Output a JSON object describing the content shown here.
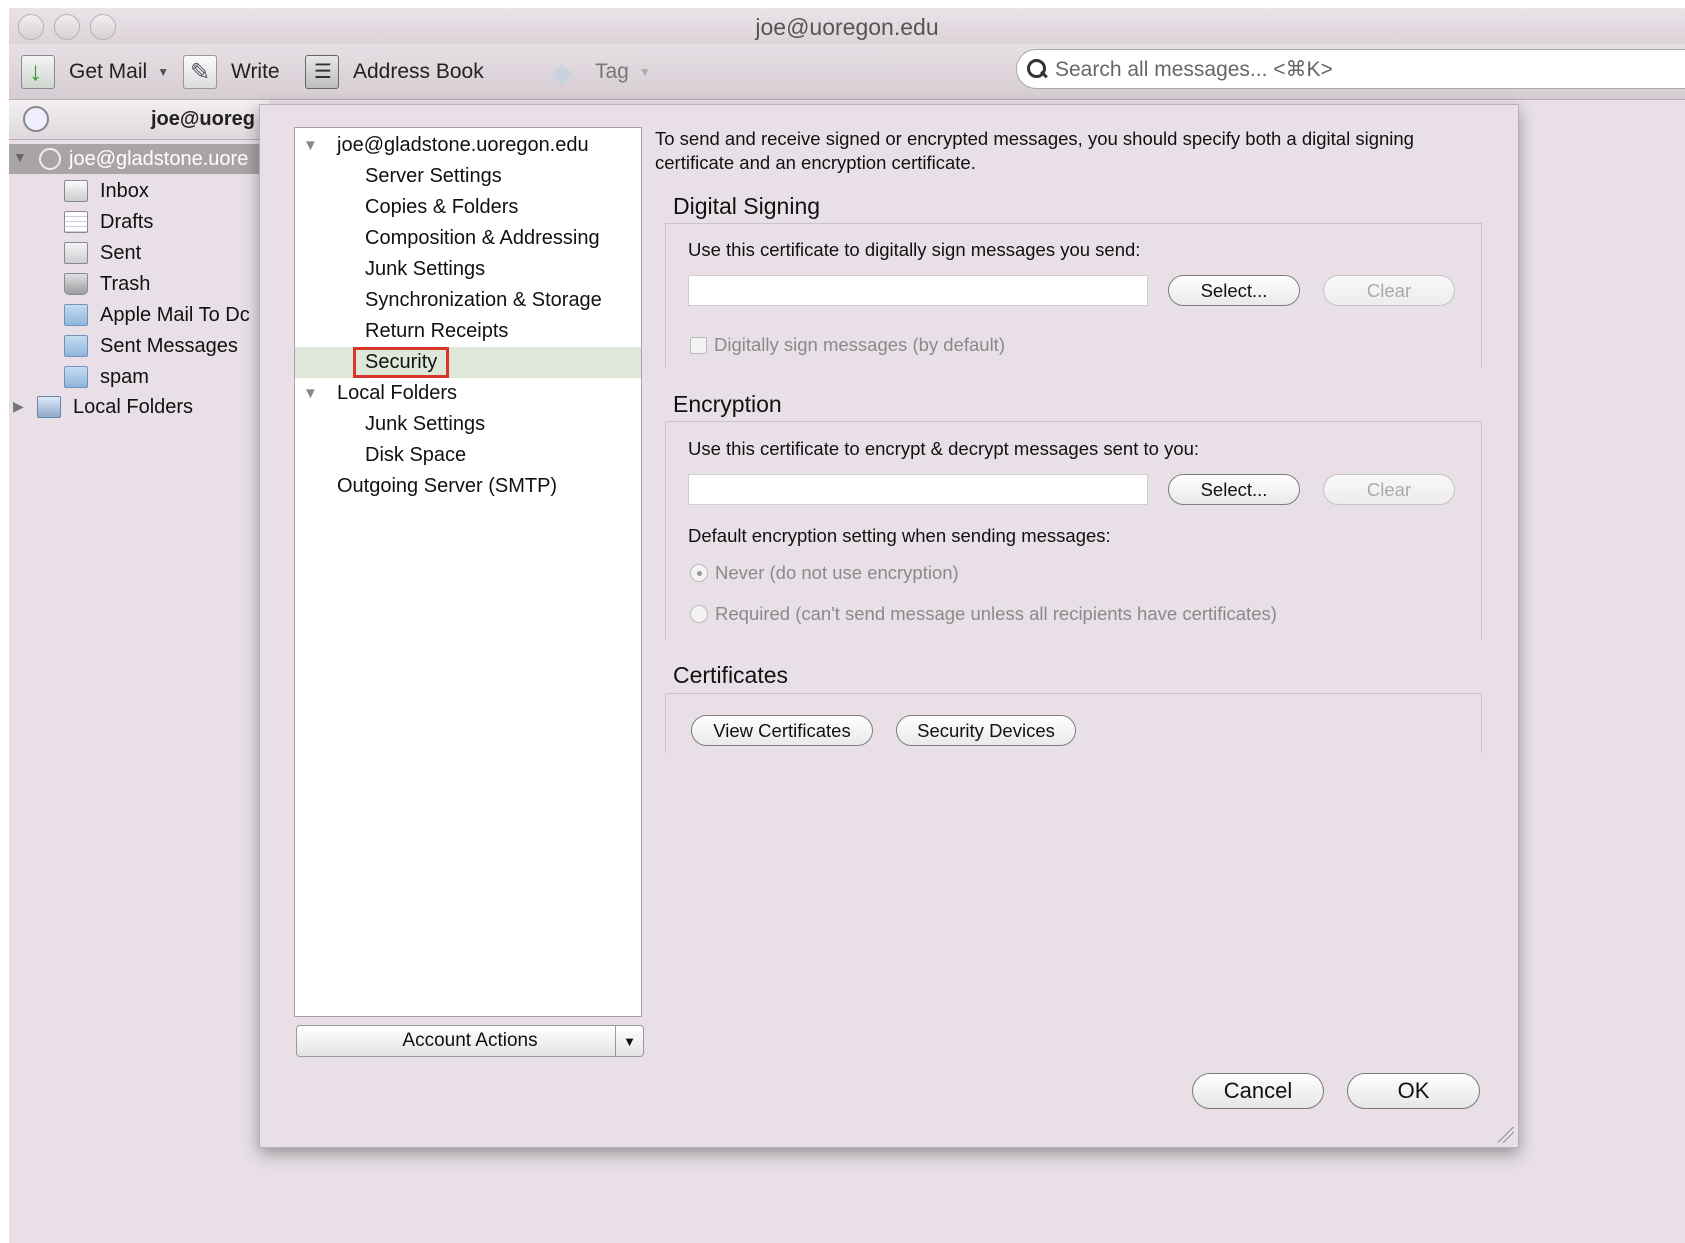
{
  "window": {
    "title": "joe@uoregon.edu"
  },
  "toolbar": {
    "get_mail": "Get Mail",
    "write": "Write",
    "address_book": "Address Book",
    "tag": "Tag",
    "search_placeholder": "Search all messages... <⌘K>"
  },
  "tabs": {
    "account_tab": "joe@uoreg"
  },
  "folders": {
    "account": "joe@gladstone.uore",
    "items": [
      {
        "label": "Inbox",
        "icon": "inbox-icon"
      },
      {
        "label": "Drafts",
        "icon": "drafts-icon"
      },
      {
        "label": "Sent",
        "icon": "sent-icon"
      },
      {
        "label": "Trash",
        "icon": "trash-icon"
      },
      {
        "label": "Apple Mail To Dc",
        "icon": "folder-icon"
      },
      {
        "label": "Sent Messages",
        "icon": "folder-icon"
      },
      {
        "label": "spam",
        "icon": "folder-icon"
      }
    ],
    "local_folders": "Local Folders"
  },
  "dialog": {
    "tree": {
      "account": "joe@gladstone.uoregon.edu",
      "account_items": [
        "Server Settings",
        "Copies & Folders",
        "Composition & Addressing",
        "Junk Settings",
        "Synchronization & Storage",
        "Return Receipts",
        "Security"
      ],
      "local_folders": "Local Folders",
      "local_items": [
        "Junk Settings",
        "Disk Space"
      ],
      "outgoing": "Outgoing Server (SMTP)",
      "selected": "Security"
    },
    "account_actions": "Account Actions",
    "intro": "To send and receive signed or encrypted messages, you should specify both a digital signing certificate and an encryption certificate.",
    "signing": {
      "title": "Digital Signing",
      "label": "Use this certificate to digitally sign messages you send:",
      "value": "",
      "select": "Select...",
      "clear": "Clear",
      "checkbox": "Digitally sign messages (by default)",
      "checked": false
    },
    "encryption": {
      "title": "Encryption",
      "label": "Use this certificate to encrypt & decrypt messages sent to you:",
      "value": "",
      "select": "Select...",
      "clear": "Clear",
      "default_label": "Default encryption setting when sending messages:",
      "option_never": "Never (do not use encryption)",
      "option_required": "Required (can't send message unless all recipients have certificates)",
      "selected": "never"
    },
    "certificates": {
      "title": "Certificates",
      "view": "View Certificates",
      "devices": "Security Devices"
    },
    "cancel": "Cancel",
    "ok": "OK"
  },
  "colors": {
    "window_bg": "#e8e0e6",
    "selection_bg": "#dfe7d9",
    "highlight_border": "#d9362b"
  }
}
